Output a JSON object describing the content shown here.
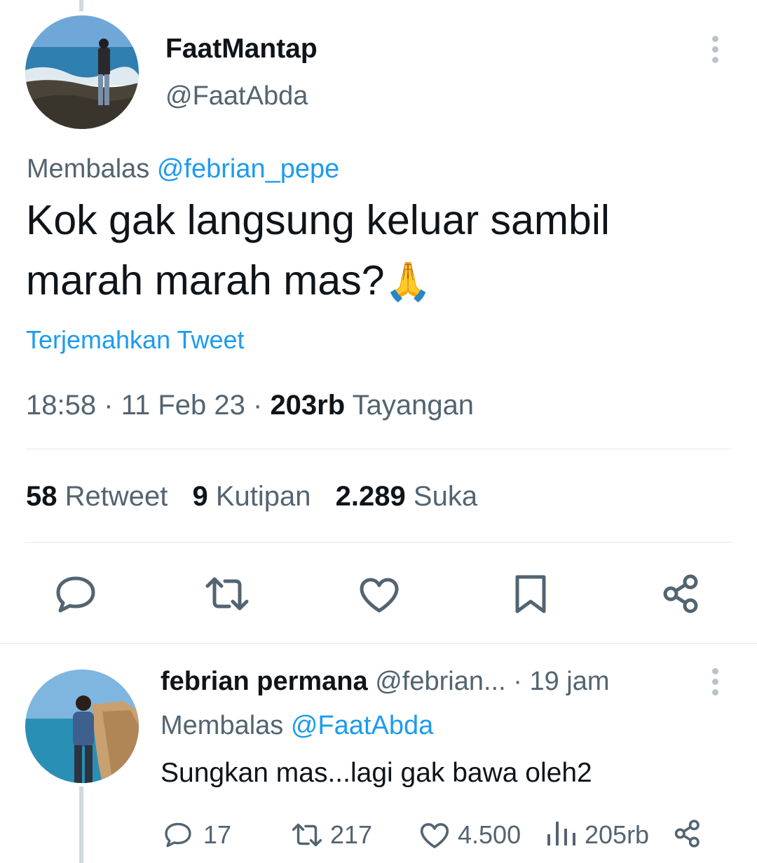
{
  "tweet": {
    "display_name": "FaatMantap",
    "handle": "@FaatAbda",
    "reply_prefix": "Membalas",
    "reply_to": "@febrian_pepe",
    "text_line1": "Kok gak langsung keluar sambil",
    "text_line2": "marah marah mas?",
    "emoji": "🙏",
    "translate_label": "Terjemahkan Tweet",
    "time": "18:58",
    "separator": "·",
    "date": "11 Feb 23",
    "views_count": "203rb",
    "views_label": "Tayangan",
    "retweets_count": "58",
    "retweets_label": "Retweet",
    "quotes_count": "9",
    "quotes_label": "Kutipan",
    "likes_count": "2.289",
    "likes_label": "Suka"
  },
  "reply": {
    "display_name": "febrian permana",
    "handle": "@febrian...",
    "time_sep": "·",
    "time": "19 jam",
    "reply_prefix": "Membalas",
    "reply_to": "@FaatAbda",
    "text": "Sungkan mas...lagi gak bawa oleh2",
    "reply_count": "17",
    "retweet_count": "217",
    "like_count": "4.500",
    "view_count": "205rb"
  },
  "colors": {
    "accent": "#1d9bf0",
    "secondary_text": "#536471",
    "divider": "#e4e8eb"
  },
  "icons": [
    "more-icon",
    "reply-icon",
    "retweet-icon",
    "like-icon",
    "bookmark-icon",
    "share-icon",
    "views-icon"
  ]
}
